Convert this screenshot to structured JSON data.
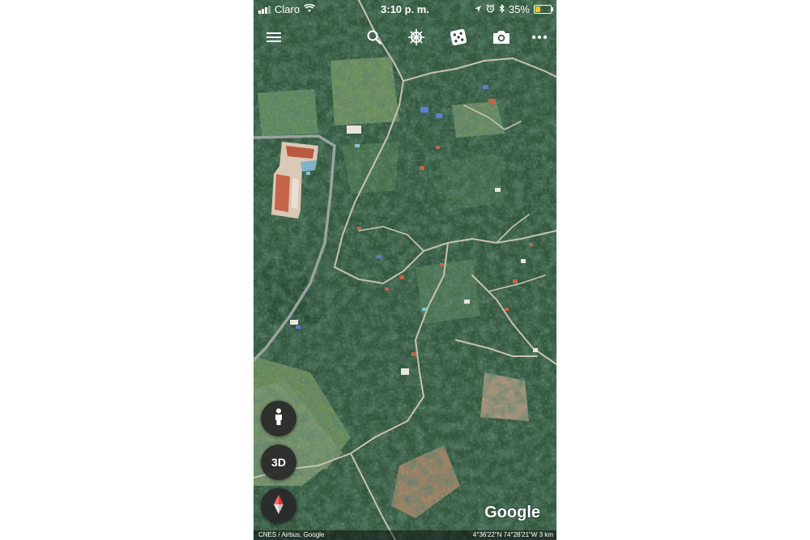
{
  "status_bar": {
    "carrier": "Claro",
    "time": "3:10 p. m.",
    "battery_percent": "35%",
    "battery_level": 0.35
  },
  "toolbar": {
    "icons": [
      "menu-icon",
      "search-icon",
      "ship-wheel-icon",
      "dice-icon",
      "camera-icon",
      "more-icon"
    ]
  },
  "controls": {
    "street_view_icon": "pegman-icon",
    "three_d_label": "3D",
    "compass_icon": "compass-icon"
  },
  "branding": {
    "logo": "Google"
  },
  "attribution": {
    "credits": "CNES / Airbus, Google",
    "coordinates": "4°36'22\"N 74°28'21\"W",
    "scale": "3 km"
  },
  "colors": {
    "vegetation": "#2f5a3f",
    "building_roof": "#c0654a",
    "road": "#c8c3b0",
    "battery_fill": "#f5c518",
    "compass_red": "#e53935"
  }
}
